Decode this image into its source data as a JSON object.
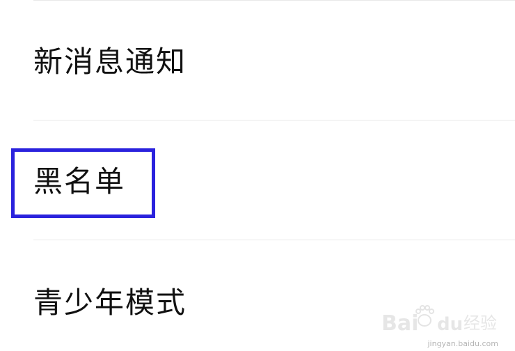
{
  "settings": {
    "items": [
      {
        "label": "新消息通知"
      },
      {
        "label": "黑名单"
      },
      {
        "label": "青少年模式"
      }
    ],
    "highlight_color": "#2a22dd"
  },
  "watermark": {
    "logo_text": "Baidu 经验",
    "url": "jingyan.baidu.com"
  }
}
